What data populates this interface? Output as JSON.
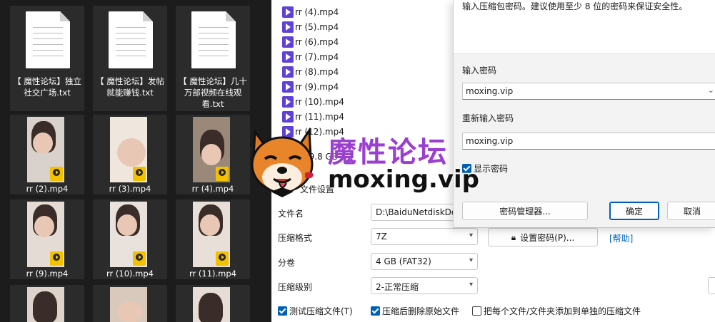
{
  "explorer": {
    "txt_files": [
      {
        "name": "【 魔性论坛】独立社交广场.txt"
      },
      {
        "name": "【 魔性论坛】发帖就能赚钱.txt"
      },
      {
        "name": "【 魔性论坛】几十万部视频在线观看.txt"
      }
    ],
    "videos_row1": [
      {
        "name": "rr (2).mp4"
      },
      {
        "name": "rr (3).mp4"
      },
      {
        "name": "rr (4).mp4"
      }
    ],
    "videos_row2": [
      {
        "name": "rr (9).mp4"
      },
      {
        "name": "rr (10).mp4"
      },
      {
        "name": "rr (11).mp4"
      }
    ],
    "badge_text": "Player"
  },
  "archive": {
    "files": [
      "rr (4).mp4",
      "rr (5).mp4",
      "rr (6).mp4",
      "rr (7).mp4",
      "rr (8).mp4",
      "rr (9).mp4",
      "rr (10).mp4",
      "rr (11).mp4",
      "rr (12).mp4"
    ],
    "size_text": "19.8 GB",
    "section_title": "文件设置",
    "filename_label": "文件名",
    "filename_value": "D:\\BaiduNetdiskDownload",
    "format_label": "压缩格式",
    "format_value": "7Z",
    "split_label": "分卷",
    "split_value": "4 GB (FAT32)",
    "level_label": "压缩级别",
    "level_value": "2-正常压缩",
    "set_password_button": "设置密码(P)...",
    "help_link": "[帮助]",
    "test_checkbox": "测试压缩文件(T)",
    "delete_checkbox": "压缩后删除原始文件",
    "separate_checkbox": "把每个文件/文件夹添加到单独的压缩文件"
  },
  "dialog": {
    "hint": "输入压缩包密码。建议使用至少 8 位的密码来保证安全性。",
    "password_label": "输入密码",
    "password_value": "moxing.vip",
    "confirm_label": "重新输入密码",
    "confirm_value": "moxing.vip",
    "show_password": "显示密码",
    "manager_button": "密码管理器...",
    "ok_button": "确定",
    "cancel_button": "取消"
  },
  "watermark": {
    "title": "魔性论坛",
    "url": "moxing.vip"
  },
  "colors": {
    "accent": "#005fb8",
    "watermark_purple": "#9b3fd1",
    "video_icon": "#5e41d6",
    "badge": "#f2c200"
  }
}
